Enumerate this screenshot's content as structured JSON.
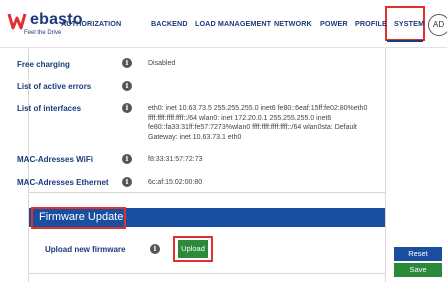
{
  "brand": {
    "name": "ebasto",
    "tagline": "Feel the Drive",
    "primary_color": "#1a3a7a",
    "accent_color": "#e03030"
  },
  "nav": {
    "items": [
      {
        "label": "AUTHORIZATION"
      },
      {
        "label": "BACKEND"
      },
      {
        "label": "LOAD MANAGEMENT"
      },
      {
        "label": "NETWORK"
      },
      {
        "label": "POWER"
      },
      {
        "label": "PROFILE"
      },
      {
        "label": "SYSTEM",
        "active": true
      }
    ],
    "user_initials": "AD"
  },
  "system": {
    "rows": [
      {
        "label": "Free charging",
        "value": "Disabled"
      },
      {
        "label": "List of active errors",
        "value": ""
      },
      {
        "label": "List of interfaces",
        "value": "eth0: inet 10.63.73.5 255.255.255.0 inet6 fe80::6eaf:15ff:fe02:80%eth0 ffff:ffff:ffff:ffff::/64 wlan0: inet 172.20.0.1 255.255.255.0 inet6 fe80::fa33:31ff:fe57:7273%wlan0 ffff:ffff:ffff:ffff::/64 wlan0sta: Default Gateway: inet 10.63.73.1 eth0"
      },
      {
        "label": "MAC-Adresses WiFi",
        "value": "f8:33:31:57:72:73"
      },
      {
        "label": "MAC-Adresses Ethernet",
        "value": "6c:af:15:02:00:80"
      }
    ]
  },
  "firmware": {
    "section_title": "Firmware Update",
    "upload_label": "Upload new firmware",
    "upload_button": "Upload"
  },
  "actions": {
    "reset_label": "Reset",
    "save_label": "Save"
  },
  "icons": {
    "info": "info-icon",
    "user": "user-avatar-icon"
  }
}
